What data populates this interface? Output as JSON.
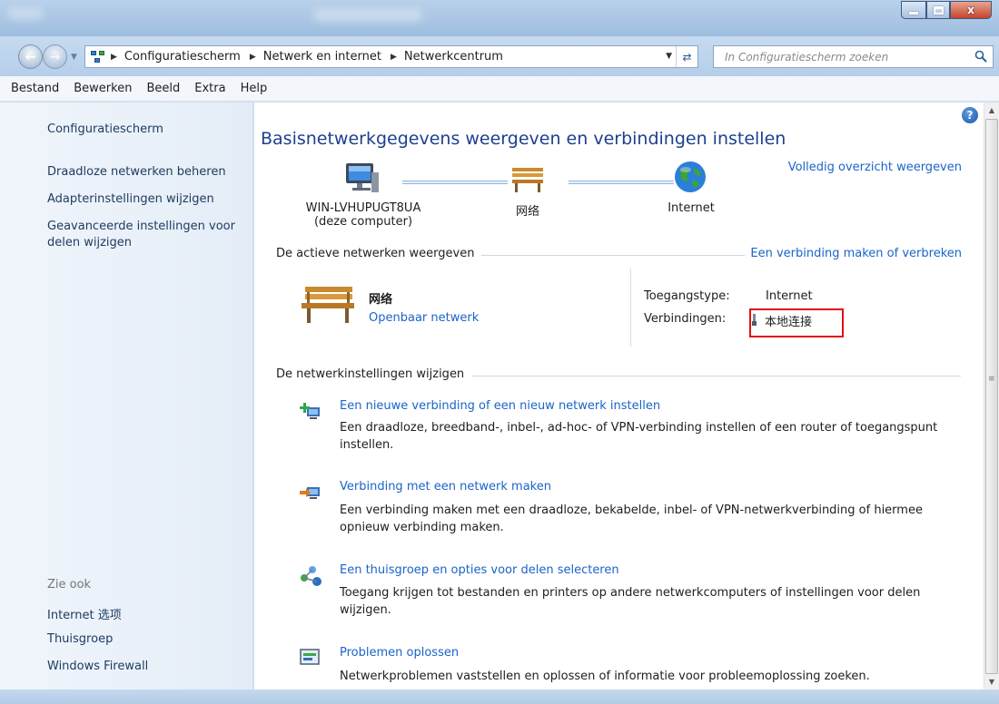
{
  "window": {
    "controls": {
      "minimize": "minimize-icon",
      "maximize": "maximize-icon",
      "close": "x"
    }
  },
  "address_bar": {
    "breadcrumbs": [
      "Configuratiescherm",
      "Netwerk en internet",
      "Netwerkcentrum"
    ]
  },
  "search": {
    "placeholder": "In Configuratiescherm zoeken"
  },
  "menu": [
    "Bestand",
    "Bewerken",
    "Beeld",
    "Extra",
    "Help"
  ],
  "sidebar": {
    "title": "Configuratiescherm",
    "links": [
      "Draadloze netwerken beheren",
      "Adapterinstellingen wijzigen",
      "Geavanceerde instellingen voor delen wijzigen"
    ],
    "see_also": "Zie ook",
    "see_also_links": [
      "Internet 选项",
      "Thuisgroep",
      "Windows Firewall"
    ]
  },
  "main": {
    "title": "Basisnetwerkgegevens weergeven en verbindingen instellen",
    "full_map_link": "Volledig overzicht weergeven",
    "map_nodes": [
      {
        "label": "WIN-LVHUPUGT8UA",
        "sub": "(deze computer)",
        "icon": "computer-icon"
      },
      {
        "label": "网络",
        "icon": "bench-icon"
      },
      {
        "label": "Internet",
        "icon": "globe-icon"
      }
    ],
    "active_networks": {
      "header": "De actieve netwerken weergeven",
      "connect_link": "Een verbinding maken of verbreken",
      "network_name": "网络",
      "network_type": "Openbaar netwerk",
      "access_type_label": "Toegangstype:",
      "access_type_value": "Internet",
      "connections_label": "Verbindingen:",
      "connections_value": "本地连接"
    },
    "change_settings": {
      "header": "De netwerkinstellingen wijzigen",
      "tasks": [
        {
          "title": "Een nieuwe verbinding of een nieuw netwerk instellen",
          "desc": "Een draadloze, breedband-, inbel-, ad-hoc- of VPN-verbinding instellen of een router of toegangspunt instellen.",
          "icon": "new-connection-icon"
        },
        {
          "title": "Verbinding met een netwerk maken",
          "desc": "Een verbinding maken met een draadloze, bekabelde, inbel- of VPN-netwerkverbinding of hiermee opnieuw verbinding maken.",
          "icon": "connect-network-icon"
        },
        {
          "title": "Een thuisgroep en opties voor delen selecteren",
          "desc": "Toegang krijgen tot bestanden en printers op andere netwerkcomputers of instellingen voor delen wijzigen.",
          "icon": "homegroup-icon"
        },
        {
          "title": "Problemen oplossen",
          "desc": "Netwerkproblemen vaststellen en oplossen of informatie voor probleemoplossing zoeken.",
          "icon": "troubleshoot-icon"
        }
      ]
    }
  },
  "colors": {
    "link": "#1a64c8",
    "title": "#1e3f8f",
    "highlight": "#e01010"
  }
}
